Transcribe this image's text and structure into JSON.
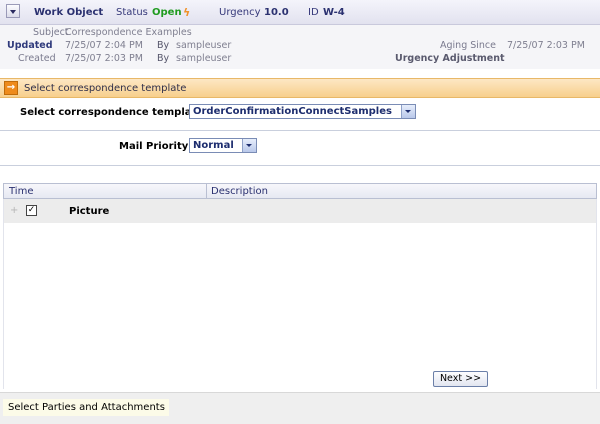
{
  "header": {
    "title": "Work Object",
    "status_label": "Status",
    "status_value": "Open",
    "urgency_label": "Urgency",
    "urgency_value": "10.0",
    "id_label": "ID",
    "id_value": "W-4",
    "status_icon": "lightning-icon"
  },
  "meta": {
    "subject_label": "Subject",
    "subject_value": "Correspondence Examples",
    "updated_label": "Updated",
    "updated_value": "7/25/07 2:04 PM",
    "updated_by_label": "By",
    "updated_by_value": "sampleuser",
    "created_label": "Created",
    "created_value": "7/25/07 2:03 PM",
    "created_by_label": "By",
    "created_by_value": "sampleuser",
    "aging_label": "Aging Since",
    "aging_value": "7/25/07 2:03 PM",
    "urgency_adj_label": "Urgency Adjustment"
  },
  "section": {
    "title": "Select correspondence template"
  },
  "form": {
    "template_label": "Select correspondence template",
    "template_value": "OrderConfirmationConnectSamples",
    "priority_label": "Mail Priority",
    "priority_value": "Normal"
  },
  "grid": {
    "columns": [
      "Time",
      "Description"
    ],
    "rows": [
      {
        "label": "Picture",
        "checked": true
      }
    ]
  },
  "actions": {
    "next_label": "Next >>"
  },
  "footer": {
    "tab_label": "Select Parties and Attachments"
  },
  "colors": {
    "accent_orange": "#ee8b1c",
    "status_green": "#1f9b1f",
    "navy": "#2b3170"
  }
}
